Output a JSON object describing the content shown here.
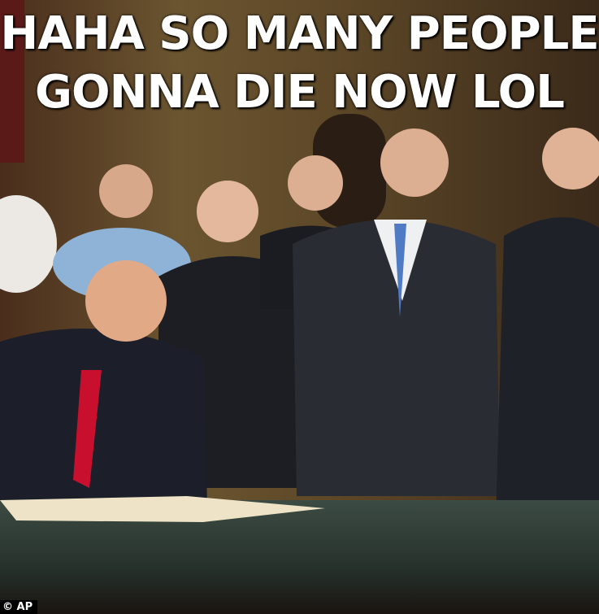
{
  "caption": {
    "line1": "HAHA SO MANY PEOPLE",
    "line2": "GONNA DIE NOW LOL"
  },
  "photo_credit": "© AP",
  "colors": {
    "caption_text": "#ffffff",
    "table_green": "#2f3d35",
    "background_gold": "#6b5530"
  }
}
